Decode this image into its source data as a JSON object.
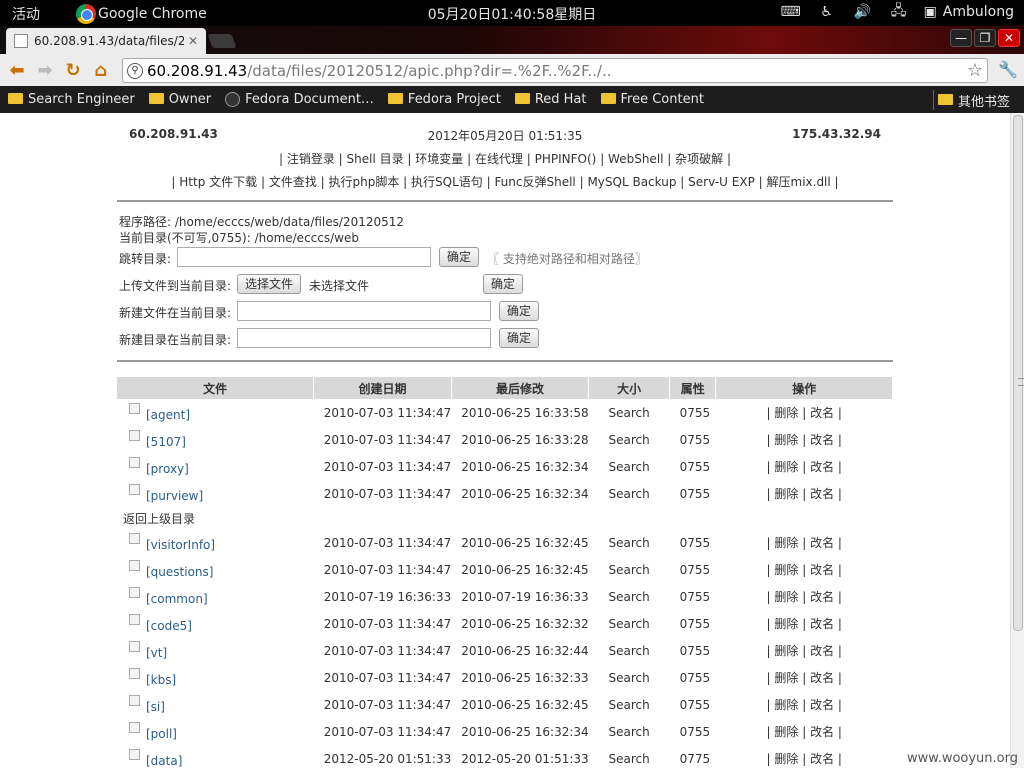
{
  "topbar": {
    "activities": "活动",
    "app_name": "Google Chrome",
    "clock": "05月20日01:40:58星期日",
    "user": "Ambulong"
  },
  "browser": {
    "tab_title": "60.208.91.43/data/files/2",
    "url_host": "60.208.91.43",
    "url_path": "/data/files/20120512/apic.php?dir=.%2F..%2F../..",
    "bookmarks": [
      {
        "label": "Search Engineer",
        "icon": "folder-icon"
      },
      {
        "label": "Owner",
        "icon": "folder-icon"
      },
      {
        "label": "Fedora Document…",
        "icon": "globe-icon"
      },
      {
        "label": "Fedora Project",
        "icon": "folder-icon"
      },
      {
        "label": "Red Hat",
        "icon": "folder-icon"
      },
      {
        "label": "Free Content",
        "icon": "folder-icon"
      }
    ],
    "other_bookmarks": "其他书签"
  },
  "page": {
    "server_ip": "60.208.91.43",
    "datetime": "2012年05月20日 01:51:35",
    "client_ip": "175.43.32.94",
    "menu1": [
      "注销登录",
      "Shell 目录",
      "环境变量",
      "在线代理",
      "PHPINFO()",
      "WebShell",
      "杂项破解"
    ],
    "menu2": [
      "Http 文件下载",
      "文件查找",
      "执行php脚本",
      "执行SQL语句",
      "Func反弹Shell",
      "MySQL Backup",
      "Serv-U EXP",
      "解压mix.dll"
    ],
    "program_path": "程序路径: /home/ecccs/web/data/files/20120512",
    "current_dir": "当前目录(不可写,0755): /home/ecccs/web",
    "jump_label": "跳转目录:",
    "jump_value": "",
    "confirm": "确定",
    "jump_note": "〖 支持绝对路径和相对路径〗",
    "upload_label": "上传文件到当前目录:",
    "choose_file": "选择文件",
    "no_file": "未选择文件",
    "newfile_label": "新建文件在当前目录:",
    "newdir_label": "新建目录在当前目录:",
    "columns": [
      "文件",
      "创建日期",
      "最后修改",
      "大小",
      "属性",
      "操作"
    ],
    "parent_dir": "返回上级目录",
    "delete": "删除",
    "rename": "改名",
    "rows_top": [
      {
        "name": "[agent]",
        "created": "2010-07-03 11:34:47",
        "modified": "2010-06-25 16:33:58",
        "size": "Search",
        "perm": "0755"
      },
      {
        "name": "[5107]",
        "created": "2010-07-03 11:34:47",
        "modified": "2010-06-25 16:33:28",
        "size": "Search",
        "perm": "0755"
      },
      {
        "name": "[proxy]",
        "created": "2010-07-03 11:34:47",
        "modified": "2010-06-25 16:32:34",
        "size": "Search",
        "perm": "0755"
      },
      {
        "name": "[purview]",
        "created": "2010-07-03 11:34:47",
        "modified": "2010-06-25 16:32:34",
        "size": "Search",
        "perm": "0755"
      }
    ],
    "rows_bottom": [
      {
        "name": "[visitorInfo]",
        "created": "2010-07-03 11:34:47",
        "modified": "2010-06-25 16:32:45",
        "size": "Search",
        "perm": "0755"
      },
      {
        "name": "[questions]",
        "created": "2010-07-03 11:34:47",
        "modified": "2010-06-25 16:32:45",
        "size": "Search",
        "perm": "0755"
      },
      {
        "name": "[common]",
        "created": "2010-07-19 16:36:33",
        "modified": "2010-07-19 16:36:33",
        "size": "Search",
        "perm": "0755"
      },
      {
        "name": "[code5]",
        "created": "2010-07-03 11:34:47",
        "modified": "2010-06-25 16:32:32",
        "size": "Search",
        "perm": "0755"
      },
      {
        "name": "[vt]",
        "created": "2010-07-03 11:34:47",
        "modified": "2010-06-25 16:32:44",
        "size": "Search",
        "perm": "0755"
      },
      {
        "name": "[kbs]",
        "created": "2010-07-03 11:34:47",
        "modified": "2010-06-25 16:32:33",
        "size": "Search",
        "perm": "0755"
      },
      {
        "name": "[si]",
        "created": "2010-07-03 11:34:47",
        "modified": "2010-06-25 16:32:45",
        "size": "Search",
        "perm": "0755"
      },
      {
        "name": "[poll]",
        "created": "2010-07-03 11:34:47",
        "modified": "2010-06-25 16:32:34",
        "size": "Search",
        "perm": "0755"
      },
      {
        "name": "[data]",
        "created": "2012-05-20 01:51:33",
        "modified": "2012-05-20 01:51:33",
        "size": "Search",
        "perm": "0775"
      }
    ]
  },
  "watermark": "www.wooyun.org",
  "colors": {
    "link": "#2b5d8a",
    "header_bg": "#d8d8d8",
    "tab_accent": "#6e0b0b"
  }
}
